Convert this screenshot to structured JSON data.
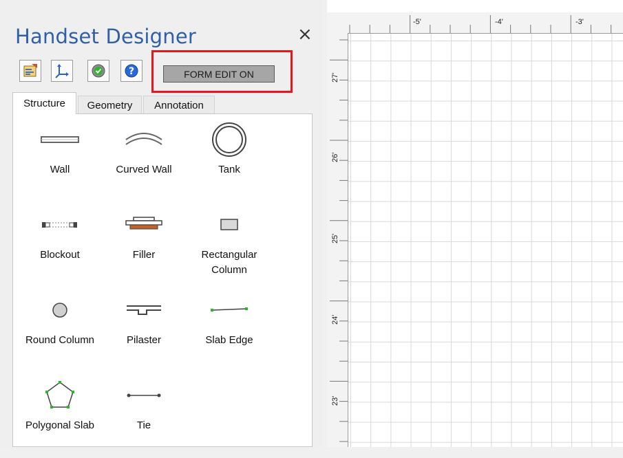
{
  "panel": {
    "title": "Handset Designer",
    "close_symbol": "×",
    "toolbar": [
      {
        "icon": "properties-icon"
      },
      {
        "icon": "axes-icon"
      },
      {
        "icon": "check-gear-icon"
      },
      {
        "icon": "help-icon"
      }
    ],
    "form_edit_label": "FORM EDIT ON",
    "highlight_color": "#e3171c",
    "tabs": [
      {
        "label": "Structure",
        "active": true
      },
      {
        "label": "Geometry",
        "active": false
      },
      {
        "label": "Annotation",
        "active": false
      }
    ],
    "shapes": [
      {
        "label": "Wall",
        "icon": "wall-icon"
      },
      {
        "label": "Curved Wall",
        "icon": "curved-wall-icon"
      },
      {
        "label": "Tank",
        "icon": "tank-icon"
      },
      {
        "label": "Blockout",
        "icon": "blockout-icon"
      },
      {
        "label": "Filler",
        "icon": "filler-icon"
      },
      {
        "label": "Rectangular Column",
        "icon": "rectangular-column-icon"
      },
      {
        "label": "Round Column",
        "icon": "round-column-icon"
      },
      {
        "label": "Pilaster",
        "icon": "pilaster-icon"
      },
      {
        "label": "Slab Edge",
        "icon": "slab-edge-icon"
      },
      {
        "label": "Polygonal Slab",
        "icon": "polygonal-slab-icon"
      },
      {
        "label": "Tie",
        "icon": "tie-icon"
      }
    ]
  },
  "ruler": {
    "top_labels": [
      "-5'",
      "-4'",
      "-3'"
    ],
    "left_labels": [
      "27'",
      "26'",
      "25'",
      "24'",
      "23'"
    ]
  },
  "colors": {
    "title": "#2f5fa8",
    "accent_green": "#2db52d",
    "filler_orange": "#c0622b"
  }
}
